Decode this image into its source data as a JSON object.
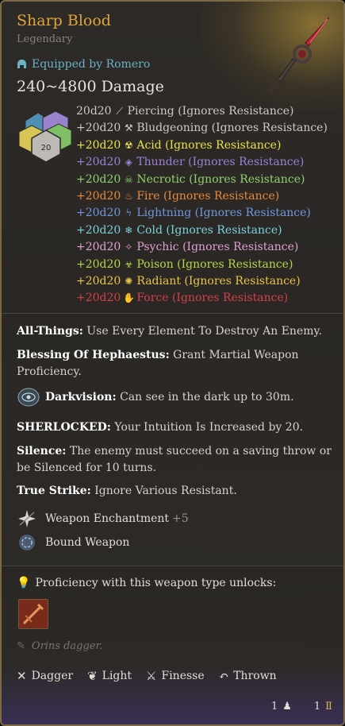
{
  "item": {
    "name": "Sharp Blood",
    "rarity": "Legendary",
    "equipped_by": "Equipped by Romero",
    "damage_total": "240~4800 Damage"
  },
  "damage_rows": [
    {
      "dice": "20d20",
      "type": "Piercing (Ignores Resistance)",
      "color": "#cfc9c2",
      "icon": "piercing-icon",
      "glyph": "⟋"
    },
    {
      "dice": "+20d20",
      "type": "Bludgeoning (Ignores Resistance)",
      "color": "#cfc9c2",
      "icon": "bludgeoning-icon",
      "glyph": "⚒"
    },
    {
      "dice": "+20d20",
      "type": "Acid (Ignores Resistance)",
      "color": "#e8e34a",
      "icon": "acid-icon",
      "glyph": "☢"
    },
    {
      "dice": "+20d20",
      "type": "Thunder (Ignores Resistance)",
      "color": "#9b82d6",
      "icon": "thunder-icon",
      "glyph": "◈"
    },
    {
      "dice": "+20d20",
      "type": "Necrotic (Ignores Resistance)",
      "color": "#8fd16e",
      "icon": "necrotic-icon",
      "glyph": "☠"
    },
    {
      "dice": "+20d20",
      "type": "Fire (Ignores Resistance)",
      "color": "#e98a3a",
      "icon": "fire-icon",
      "glyph": "♨"
    },
    {
      "dice": "+20d20",
      "type": "Lightning (Ignores Resistance)",
      "color": "#6f98e0",
      "icon": "lightning-icon",
      "glyph": "ϟ"
    },
    {
      "dice": "+20d20",
      "type": "Cold (Ignores Resistance)",
      "color": "#7ad3dc",
      "icon": "cold-icon",
      "glyph": "❄"
    },
    {
      "dice": "+20d20",
      "type": "Psychic (Ignores Resistance)",
      "color": "#e2a0d2",
      "icon": "psychic-icon",
      "glyph": "✧"
    },
    {
      "dice": "+20d20",
      "type": "Poison (Ignores Resistance)",
      "color": "#b2d94a",
      "icon": "poison-icon",
      "glyph": "☣"
    },
    {
      "dice": "+20d20",
      "type": "Radiant (Ignores Resistance)",
      "color": "#e8c54a",
      "icon": "radiant-icon",
      "glyph": "✺"
    },
    {
      "dice": "+20d20",
      "type": "Force (Ignores Resistance)",
      "color": "#d4404a",
      "icon": "force-icon",
      "glyph": "✋"
    }
  ],
  "passives": {
    "all_things_title": "All-Things:",
    "all_things_text": " Use Every Element To Destroy An Enemy.",
    "hephaestus_title": "Blessing Of Hephaestus:",
    "hephaestus_text": " Grant Martial Weapon Proficiency.",
    "darkvision_title": "Darkvision:",
    "darkvision_text": " Can see in the dark up to 30m.",
    "sherlocked_title": "SHERLOCKED:",
    "sherlocked_text": " Your Intuition Is Increased by 20.",
    "silence_title": "Silence:",
    "silence_text": " The enemy must succeed on a saving throw or be Silenced for 10 turns.",
    "true_strike_title": "True Strike:",
    "true_strike_text": " Ignore Various Resistant."
  },
  "enchantments": {
    "weapon_enchantment": "Weapon Enchantment",
    "weapon_enchantment_bonus": "+5",
    "bound_weapon": "Bound Weapon"
  },
  "proficiency": {
    "label": "Proficiency with this weapon type unlocks:"
  },
  "flavor": "Orins dagger.",
  "properties": [
    {
      "label": "Dagger",
      "icon": "dagger-icon",
      "glyph": "✕"
    },
    {
      "label": "Light",
      "icon": "light-icon",
      "glyph": "❦"
    },
    {
      "label": "Finesse",
      "icon": "finesse-icon",
      "glyph": "⚔"
    },
    {
      "label": "Thrown",
      "icon": "thrown-icon",
      "glyph": "↶"
    }
  ],
  "footer": {
    "weight_value": "1",
    "price_value": "1"
  }
}
